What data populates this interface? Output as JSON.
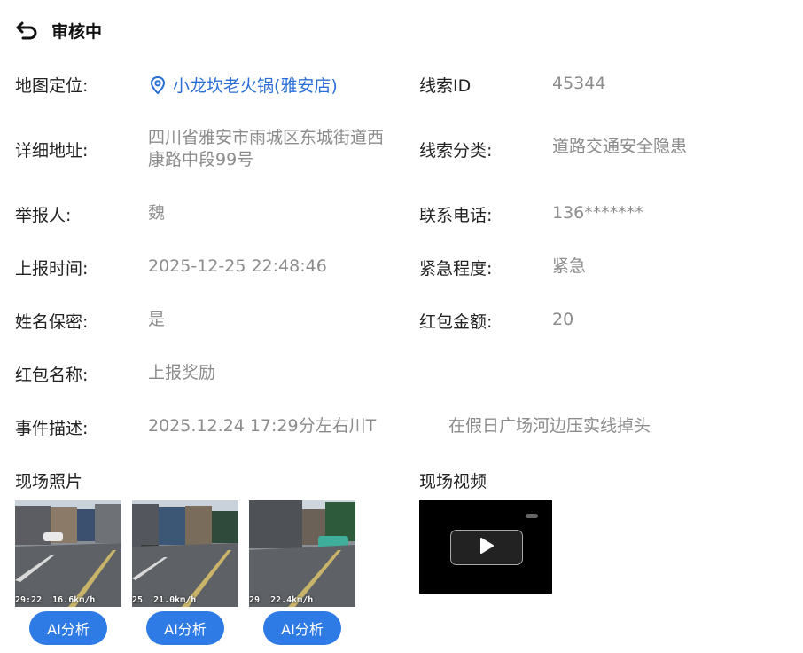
{
  "header": {
    "title": "审核中",
    "back_icon": "back-arrow-icon"
  },
  "info": {
    "map_label": "地图定位:",
    "map_value": "小龙坎老火锅(雅安店)",
    "clue_id_label": "线索ID",
    "clue_id_value": "45344",
    "address_label": "详细地址:",
    "address_line1": "四川省雅安市雨城区东城街道西",
    "address_line2": "康路中段99号",
    "clue_type_label": "线索分类:",
    "clue_type_value": "道路交通安全隐患",
    "reporter_label": "举报人:",
    "reporter_value": "魏",
    "phone_label": "联系电话:",
    "phone_value": "136*******",
    "time_label": "上报时间:",
    "time_value": "2025-12-25 22:48:46",
    "urgency_label": "紧急程度:",
    "urgency_value": "紧急",
    "anonymous_label": "姓名保密:",
    "anonymous_value": "是",
    "redpacket_amount_label": "红包金额:",
    "redpacket_amount_value": "20",
    "redpacket_name_label": "红包名称:",
    "redpacket_name_value": "上报奖励",
    "event_label": "事件描述:",
    "event_value_part1": "2025.12.24 17:29分左右川T",
    "event_value_part2": "在假日广场河边压实线掉头"
  },
  "photos": {
    "title": "现场照片",
    "items": [
      {
        "overlay": "29:22  16.6km/h",
        "button": "AI分析"
      },
      {
        "overlay": "25  21.0km/h",
        "button": "AI分析"
      },
      {
        "overlay": "29  22.4km/h",
        "button": "AI分析"
      }
    ]
  },
  "video": {
    "title": "现场视频",
    "play_icon": "play-icon"
  },
  "colors": {
    "accent": "#2f7be6",
    "link": "#2a6fd6",
    "value_gray": "#8c8c8c"
  }
}
